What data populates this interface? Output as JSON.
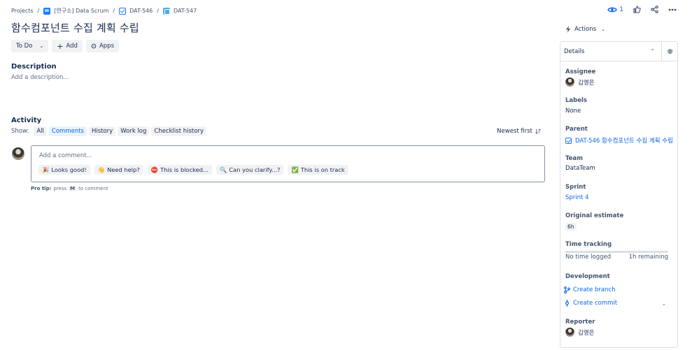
{
  "breadcrumb": {
    "projects": "Projects",
    "project": "[연구소] Data Scrum",
    "parent_key": "DAT-546",
    "issue_key": "DAT-547"
  },
  "toolbar": {
    "watch_count": "1",
    "icons": [
      "eye-icon",
      "thumbs-up-icon",
      "share-icon",
      "more-icon"
    ]
  },
  "issue": {
    "title": "함수컴포넌트 수집 계획 수립",
    "status_button": "To Do",
    "add_button": "Add",
    "apps_button": "Apps"
  },
  "description": {
    "heading": "Description",
    "placeholder": "Add a description..."
  },
  "activity": {
    "heading": "Activity",
    "show_label": "Show:",
    "filters": [
      "All",
      "Comments",
      "History",
      "Work log",
      "Checklist history"
    ],
    "active_filter": "Comments",
    "sort_label": "Newest first",
    "comment_placeholder": "Add a comment...",
    "quick_replies": [
      {
        "emoji": "🎉",
        "text": "Looks good!"
      },
      {
        "emoji": "👋",
        "text": "Need help?"
      },
      {
        "emoji": "⛔",
        "text": "This is blocked..."
      },
      {
        "emoji": "🔍",
        "text": "Can you clarify...?"
      },
      {
        "emoji": "✅",
        "text": "This is on track"
      }
    ],
    "protip_bold": "Pro tip:",
    "protip_press": "press",
    "protip_key": "M",
    "protip_tail": "to comment"
  },
  "sidebar": {
    "actions_label": "Actions",
    "panel_title": "Details",
    "assignee_label": "Assignee",
    "assignee_value": "김영은",
    "labels_label": "Labels",
    "labels_value": "None",
    "parent_label": "Parent",
    "parent_value": "DAT-546 함수컴포넌트 수집 계획 수립",
    "team_label": "Team",
    "team_value": "DataTeam",
    "sprint_label": "Sprint",
    "sprint_value": "Sprint 4",
    "estimate_label": "Original estimate",
    "estimate_value": "6h",
    "time_label": "Time tracking",
    "time_logged": "No time logged",
    "time_remaining": "1h remaining",
    "time_progress": 0,
    "development_label": "Development",
    "create_branch": "Create branch",
    "create_commit": "Create commit",
    "reporter_label": "Reporter",
    "reporter_value": "김영은"
  },
  "colors": {
    "link": "#0c66e4",
    "text": "#172b4d",
    "subtle": "#44546f",
    "neutral_bg": "#f1f2f4",
    "selected_bg": "#e9f2ff"
  }
}
